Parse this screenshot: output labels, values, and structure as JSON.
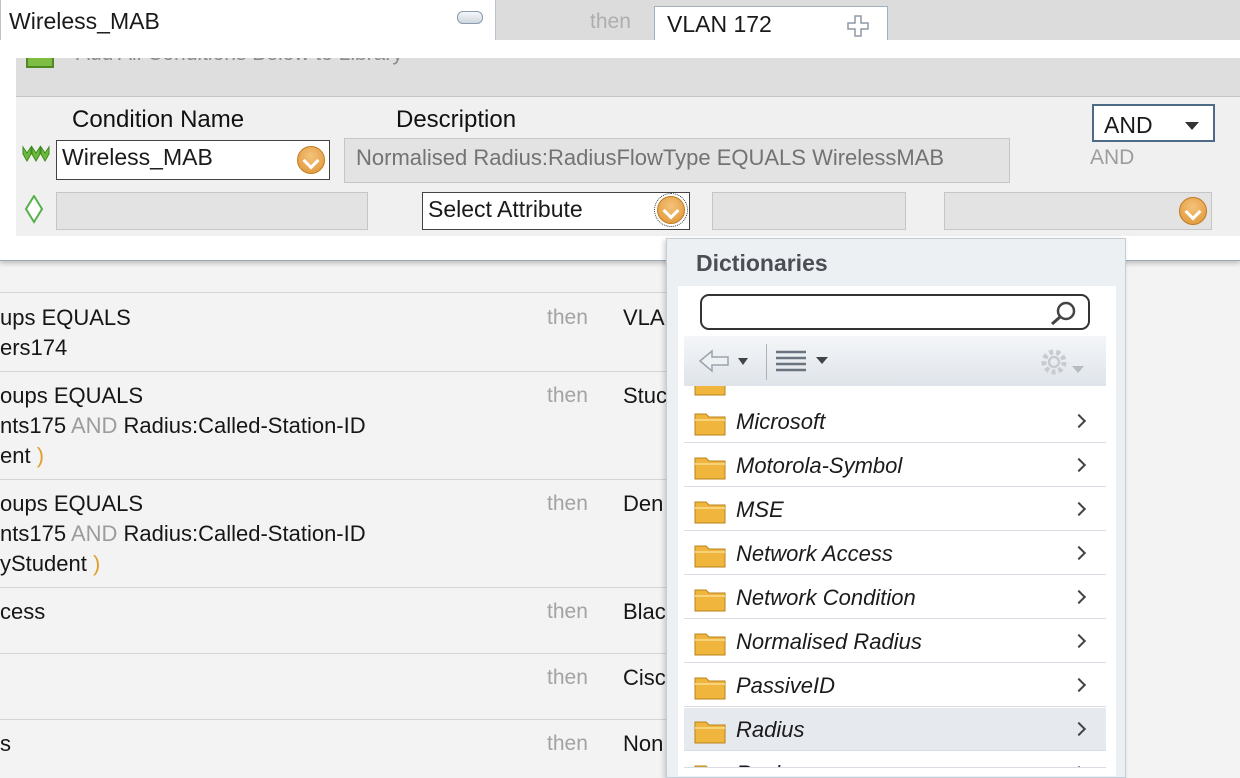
{
  "header": {
    "rule_name": "Wireless_MAB",
    "then": "then",
    "result": "VLAN 172"
  },
  "editor": {
    "add_to_library": "Add All Conditions Below to Library",
    "col_condition_name": "Condition Name",
    "col_description": "Description",
    "operator_value": "AND",
    "operator_hint": "AND",
    "row1": {
      "name": "Wireless_MAB",
      "description": "Normalised Radius:RadiusFlowType EQUALS WirelessMAB"
    },
    "row2": {
      "name": "",
      "attribute_placeholder": "Select Attribute",
      "operator": "",
      "value": ""
    }
  },
  "policy_rows": [
    {
      "lines": [
        "ups EQUALS",
        "ers174"
      ],
      "then": "then",
      "result": "VLA"
    },
    {
      "lines": [
        "oups EQUALS",
        "nts175 AND Radius:Called-Station-ID",
        "ent )"
      ],
      "then": "then",
      "result": "Stuc"
    },
    {
      "lines": [
        "oups EQUALS",
        "nts175 AND Radius:Called-Station-ID",
        "yStudent )"
      ],
      "then": "then",
      "result": "Den"
    },
    {
      "lines": [
        "cess"
      ],
      "then": "then",
      "result": "Blac"
    },
    {
      "lines": [
        ""
      ],
      "then": "then",
      "result": "Ciscc"
    },
    {
      "lines": [
        "s"
      ],
      "then": "then",
      "result": "Non"
    }
  ],
  "dictionaries": {
    "title": "Dictionaries",
    "search_value": "",
    "items": [
      "Microsoft",
      "Motorola-Symbol",
      "MSE",
      "Network Access",
      "Network Condition",
      "Normalised Radius",
      "PassiveID",
      "Radius",
      "Ruckus"
    ],
    "selected": "Radius"
  },
  "colors": {
    "accent_orange": "#df9333",
    "operator_keyword": "#9c9c9c",
    "paren": "#e0a02c",
    "folder": "#f0b53c"
  }
}
